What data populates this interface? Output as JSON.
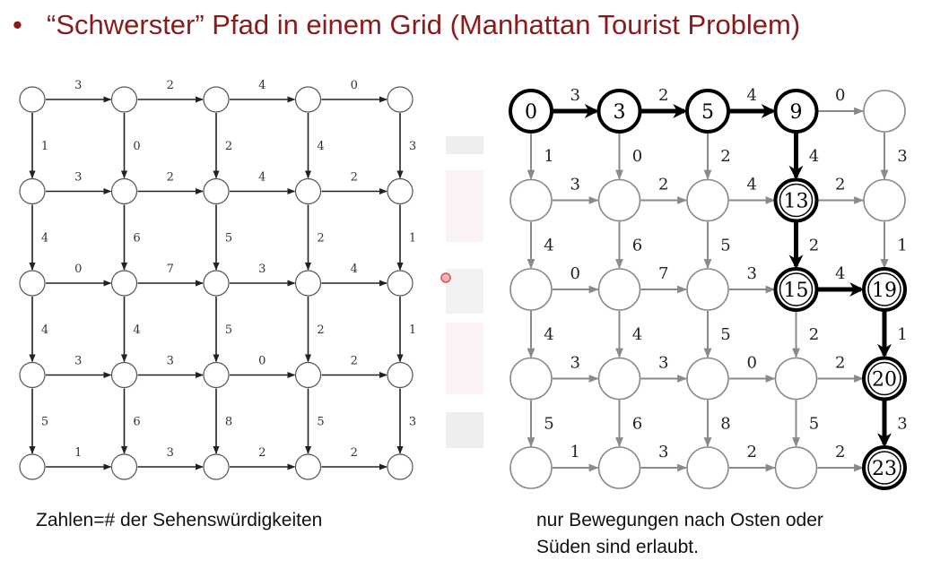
{
  "title": {
    "bullet": "•",
    "text": "“Schwerster” Pfad in einem Grid (Manhattan Tourist Problem)"
  },
  "captions": {
    "left": "Zahlen=# der Sehenswürdigkeiten",
    "right_line1": "nur Bewegungen nach Osten oder",
    "right_line2": "Süden sind erlaubt."
  },
  "colors": {
    "title": "#8b1a1a",
    "left_edges": "#222222",
    "right_edges": "#8a8a8a",
    "path": "#000000"
  },
  "grid": {
    "rows": 5,
    "cols": 5,
    "east": [
      [
        "3",
        "2",
        "4",
        "0"
      ],
      [
        "3",
        "2",
        "4",
        "2"
      ],
      [
        "0",
        "7",
        "3",
        "4"
      ],
      [
        "3",
        "3",
        "0",
        "2"
      ],
      [
        "1",
        "3",
        "2",
        "2"
      ]
    ],
    "south": [
      [
        "1",
        "0",
        "2",
        "4",
        "3"
      ],
      [
        "4",
        "6",
        "5",
        "2",
        "1"
      ],
      [
        "4",
        "4",
        "5",
        "2",
        "1"
      ],
      [
        "5",
        "6",
        "8",
        "5",
        "3"
      ]
    ]
  },
  "solution": {
    "node_values": [
      {
        "r": 0,
        "c": 0,
        "label": "0"
      },
      {
        "r": 0,
        "c": 1,
        "label": "3"
      },
      {
        "r": 0,
        "c": 2,
        "label": "5"
      },
      {
        "r": 0,
        "c": 3,
        "label": "9"
      },
      {
        "r": 1,
        "c": 3,
        "label": "13"
      },
      {
        "r": 2,
        "c": 3,
        "label": "15"
      },
      {
        "r": 2,
        "c": 4,
        "label": "19"
      },
      {
        "r": 3,
        "c": 4,
        "label": "20"
      },
      {
        "r": 4,
        "c": 4,
        "label": "23"
      }
    ],
    "path": [
      [
        0,
        0
      ],
      [
        0,
        1
      ],
      [
        0,
        2
      ],
      [
        0,
        3
      ],
      [
        1,
        3
      ],
      [
        2,
        3
      ],
      [
        2,
        4
      ],
      [
        3,
        4
      ],
      [
        4,
        4
      ]
    ]
  }
}
